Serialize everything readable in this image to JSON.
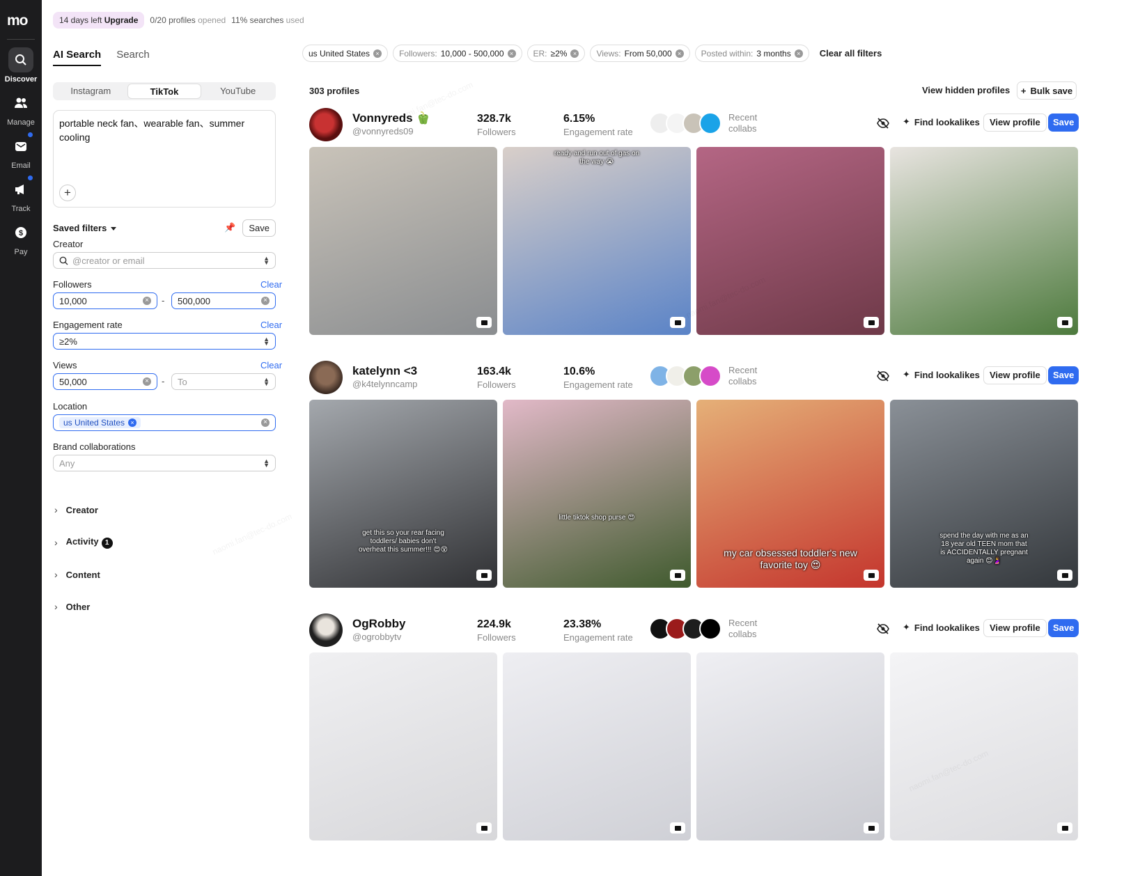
{
  "rail": {
    "logo": "mo",
    "items": [
      {
        "label": "Discover",
        "icon": "search-icon"
      },
      {
        "label": "Manage",
        "icon": "users-icon"
      },
      {
        "label": "Email",
        "icon": "mail-icon"
      },
      {
        "label": "Track",
        "icon": "megaphone-icon"
      },
      {
        "label": "Pay",
        "icon": "dollar-icon"
      }
    ]
  },
  "topbar": {
    "trial_days": "14 days left",
    "upgrade": "Upgrade",
    "profiles_count": "0/20 profiles",
    "profiles_suffix": "opened",
    "searches_pct": "11% searches",
    "searches_suffix": "used"
  },
  "search_modes": [
    "AI Search",
    "Search"
  ],
  "platforms": [
    "Instagram",
    "TikTok",
    "YouTube"
  ],
  "prompt_text": "portable neck fan、wearable fan、summer cooling",
  "saved_filters": {
    "label": "Saved filters",
    "save": "Save"
  },
  "filters_panel": {
    "creator": {
      "label": "Creator",
      "placeholder": "@creator or email"
    },
    "followers": {
      "label": "Followers",
      "clear": "Clear",
      "min": "10,000",
      "max": "500,000"
    },
    "engagement": {
      "label": "Engagement rate",
      "clear": "Clear",
      "value": "≥2%"
    },
    "views": {
      "label": "Views",
      "clear": "Clear",
      "min": "50,000",
      "max_placeholder": "To"
    },
    "location": {
      "label": "Location",
      "value": "us United States"
    },
    "brand": {
      "label": "Brand collaborations",
      "placeholder": "Any"
    },
    "sections": [
      {
        "label": "Creator"
      },
      {
        "label": "Activity",
        "badge": "1"
      },
      {
        "label": "Content"
      },
      {
        "label": "Other"
      }
    ],
    "dash": "-"
  },
  "active_filters": [
    {
      "key": "",
      "value": "us United States"
    },
    {
      "key": "Followers:",
      "value": "10,000 - 500,000"
    },
    {
      "key": "ER:",
      "value": "≥2%"
    },
    {
      "key": "Views:",
      "value": "From 50,000"
    },
    {
      "key": "Posted within:",
      "value": "3 months"
    }
  ],
  "clear_all": "Clear all filters",
  "results": {
    "count": "303 profiles",
    "view_hidden": "View hidden profiles",
    "bulk_save": "Bulk save"
  },
  "creator_actions": {
    "find": "Find lookalikes",
    "view": "View profile",
    "save": "Save",
    "recent": "Recent",
    "collabs": "collabs",
    "followers_label": "Followers",
    "er_label": "Engagement rate"
  },
  "creators": [
    {
      "name": "Vonnyreds 🫑",
      "handle": "@vonnyreds09",
      "followers": "328.7k",
      "er": "6.15%",
      "collab_colors": [
        "#eeeeee",
        "#f4f4f4",
        "#c9c3b8",
        "#1aa3e8"
      ],
      "thumbs": [
        {
          "colors": [
            "#8a8d90",
            "#c9c3b9"
          ],
          "caption": ""
        },
        {
          "colors": [
            "#5a83c7",
            "#d9cfc9"
          ],
          "caption": "ready and run out of gas on the way 😭"
        },
        {
          "colors": [
            "#6e3948",
            "#b46684"
          ],
          "caption": ""
        },
        {
          "colors": [
            "#4d7a3d",
            "#e8e4e0"
          ],
          "caption": ""
        }
      ]
    },
    {
      "name": "katelynn <3",
      "handle": "@k4telynncamp",
      "followers": "163.4k",
      "er": "10.6%",
      "collab_colors": [
        "#7fb3e6",
        "#f0efe9",
        "#8c9f6a",
        "#d64bc8"
      ],
      "thumbs": [
        {
          "colors": [
            "#2f3033",
            "#a4a8ad"
          ],
          "caption": "get this so your rear facing toddlers/ babies don't overheat this summer!!! 😍😵"
        },
        {
          "colors": [
            "#3f5a2d",
            "#e2b9c8"
          ],
          "caption": "little tiktok shop purse 😍"
        },
        {
          "colors": [
            "#c4352d",
            "#e5b078"
          ],
          "caption": "my car obsessed toddler's new favorite toy 😍"
        },
        {
          "colors": [
            "#33373b",
            "#8a9097"
          ],
          "caption": "spend the day with me as an 18 year old TEEN mom that is ACCIDENTALLY pregnant again 😊🤰"
        }
      ]
    },
    {
      "name": "OgRobby",
      "handle": "@ogrobbytv",
      "followers": "224.9k",
      "er": "23.38%",
      "collab_colors": [
        "#111111",
        "#9b1b1b",
        "#1d1d1d",
        "#000000"
      ],
      "thumbs": [
        {
          "colors": [
            "#d7d7da",
            "#f0f0f2"
          ],
          "caption": ""
        },
        {
          "colors": [
            "#cfd0d6",
            "#eeeef2"
          ],
          "caption": ""
        },
        {
          "colors": [
            "#c9cad0",
            "#efeff3"
          ],
          "caption": ""
        },
        {
          "colors": [
            "#dcdcdf",
            "#f4f4f6"
          ],
          "caption": ""
        }
      ]
    }
  ],
  "accent": "#2f6bf0"
}
